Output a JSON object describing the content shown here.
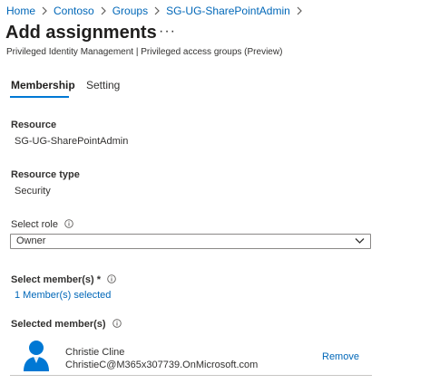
{
  "breadcrumb": [
    "Home",
    "Contoso",
    "Groups",
    "SG-UG-SharePointAdmin"
  ],
  "header": {
    "title": "Add assignments",
    "more": "···",
    "subtitle": "Privileged Identity Management | Privileged access groups (Preview)"
  },
  "tabs": [
    {
      "label": "Membership",
      "active": true
    },
    {
      "label": "Setting",
      "active": false
    }
  ],
  "resource": {
    "label": "Resource",
    "value": "SG-UG-SharePointAdmin"
  },
  "resource_type": {
    "label": "Resource type",
    "value": "Security"
  },
  "select_role": {
    "label": "Select role",
    "value": "Owner"
  },
  "select_members": {
    "label": "Select member(s) *",
    "link": "1 Member(s) selected"
  },
  "selected_members": {
    "label": "Selected member(s)",
    "items": [
      {
        "name": "Christie Cline",
        "email": "ChristieC@M365x307739.OnMicrosoft.com",
        "action": "Remove"
      }
    ]
  },
  "colors": {
    "accent": "#0078d4",
    "link": "#0067b8",
    "avatar": "#0078d4"
  },
  "icons": [
    "chevron-right-icon",
    "info-icon",
    "chevron-down-icon",
    "user-avatar-icon"
  ]
}
